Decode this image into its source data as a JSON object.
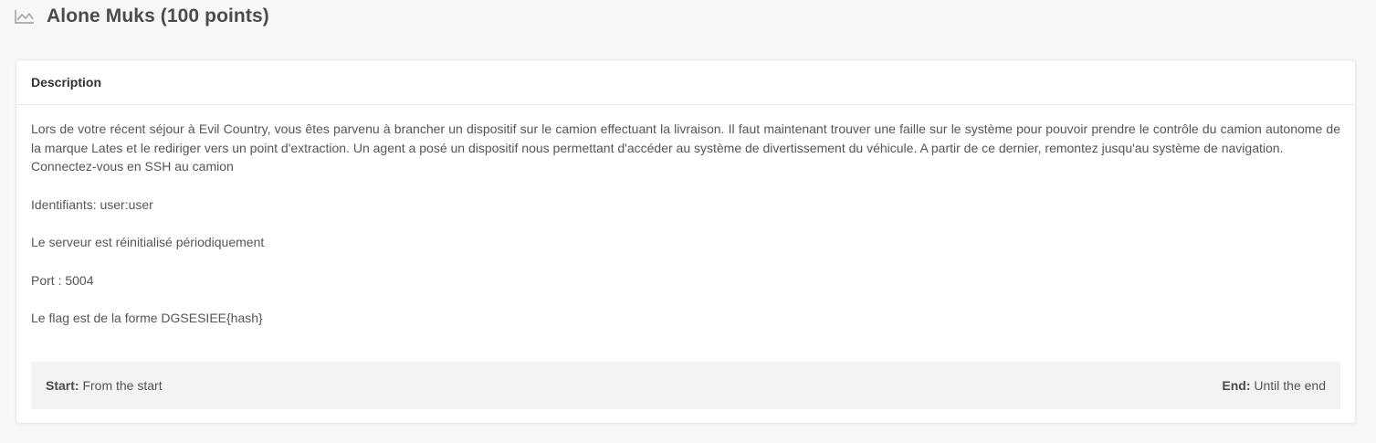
{
  "header": {
    "icon": "line-chart-icon",
    "title": "Alone Muks (100 points)"
  },
  "card": {
    "header_title": "Description",
    "description_paragraph": "Lors de votre récent séjour à Evil Country, vous êtes parvenu à brancher un dispositif sur le camion effectuant la livraison. Il faut maintenant trouver une faille sur le système pour pouvoir prendre le contrôle du camion autonome de la marque Lates et le rediriger vers un point d'extraction. Un agent a posé un dispositif nous permettant d'accéder au système de divertissement du véhicule. A partir de ce dernier, remontez jusqu'au système de navigation.",
    "ssh_line": "Connectez-vous en SSH au camion",
    "credentials_line": "Identifiants: user:user",
    "reset_line": "Le serveur est réinitialisé périodiquement",
    "port_line": "Port : 5004",
    "flag_line": "Le flag est de la forme DGSESIEE{hash}",
    "footer": {
      "start_label": "Start:",
      "start_value": "From the start",
      "end_label": "End:",
      "end_value": "Until the end"
    }
  }
}
